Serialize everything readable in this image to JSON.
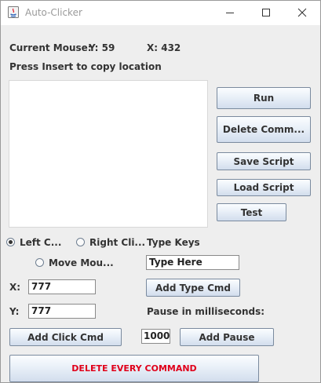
{
  "window": {
    "title": "Auto-Clicker",
    "minimize_icon": "minimize-icon",
    "maximize_icon": "maximize-icon",
    "close_icon": "close-icon"
  },
  "mouse": {
    "current_label": "Current Mouse:",
    "y_text": "Y: 59",
    "x_text": "X: 432",
    "hint": "Press Insert to copy location"
  },
  "script_area": {
    "value": ""
  },
  "buttons": {
    "run": "Run",
    "delete_command": "Delete Comm...",
    "save_script": "Save Script",
    "load_script": "Load Script",
    "test": "Test",
    "add_type_cmd": "Add Type Cmd",
    "add_click_cmd": "Add Click Cmd",
    "add_pause": "Add Pause",
    "delete_every_command": "DELETE EVERY COMMAND"
  },
  "click_type": {
    "options": [
      "Left C...",
      "Right Cli...",
      "Move Mou..."
    ],
    "selected": "Left C..."
  },
  "type_keys": {
    "label": "Type Keys",
    "value": "Type Here"
  },
  "coords": {
    "x_label": "X:",
    "x_value": "777",
    "y_label": "Y:",
    "y_value": "777"
  },
  "pause": {
    "label": "Pause in milliseconds:",
    "value": "1000"
  },
  "colors": {
    "danger_text": "#e0001b",
    "background": "#eeeeee"
  }
}
